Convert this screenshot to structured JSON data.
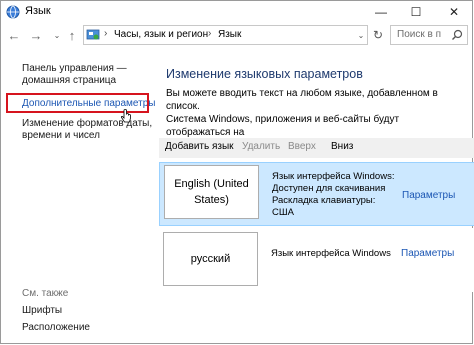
{
  "window": {
    "title": "Язык",
    "minimize": "—",
    "maximize": "☐",
    "close": "✕"
  },
  "address": {
    "back": "←",
    "forward": "→",
    "history": "⌄",
    "up": "↑",
    "separator": "›",
    "crumbs": [
      "Часы, язык и регион",
      "Язык"
    ],
    "dropdown": "⌄",
    "refresh": "↻",
    "search_placeholder": "Поиск в п"
  },
  "sidebar": {
    "home_line1": "Панель управления —",
    "home_line2": "домашняя страница",
    "advanced": "Дополнительные параметры",
    "formats_line1": "Изменение форматов даты,",
    "formats_line2": "времени и чисел",
    "see_also": "См. также",
    "fonts": "Шрифты",
    "location": "Расположение"
  },
  "main": {
    "title": "Изменение языковых параметров",
    "description": "Вы можете вводить текст на любом языке, добавленном в список.\nСистема Windows, приложения и веб-сайты будут отображаться на\nпервом поддерживаемом языке из списка."
  },
  "toolbar": {
    "add": "Добавить язык",
    "delete": "Удалить",
    "up": "Вверх",
    "down": "Вниз"
  },
  "languages": [
    {
      "name": "English (United States)",
      "info": "Язык интерфейса Windows:\nДоступен для скачивания\nРаскладка клавиатуры:\nСША",
      "params": "Параметры"
    },
    {
      "name": "русский",
      "info": "Язык интерфейса Windows",
      "params": "Параметры"
    }
  ],
  "colors": {
    "accent_link": "#1b56b3",
    "highlight_box": "#d6141e",
    "selected_row": "#cce8ff"
  }
}
